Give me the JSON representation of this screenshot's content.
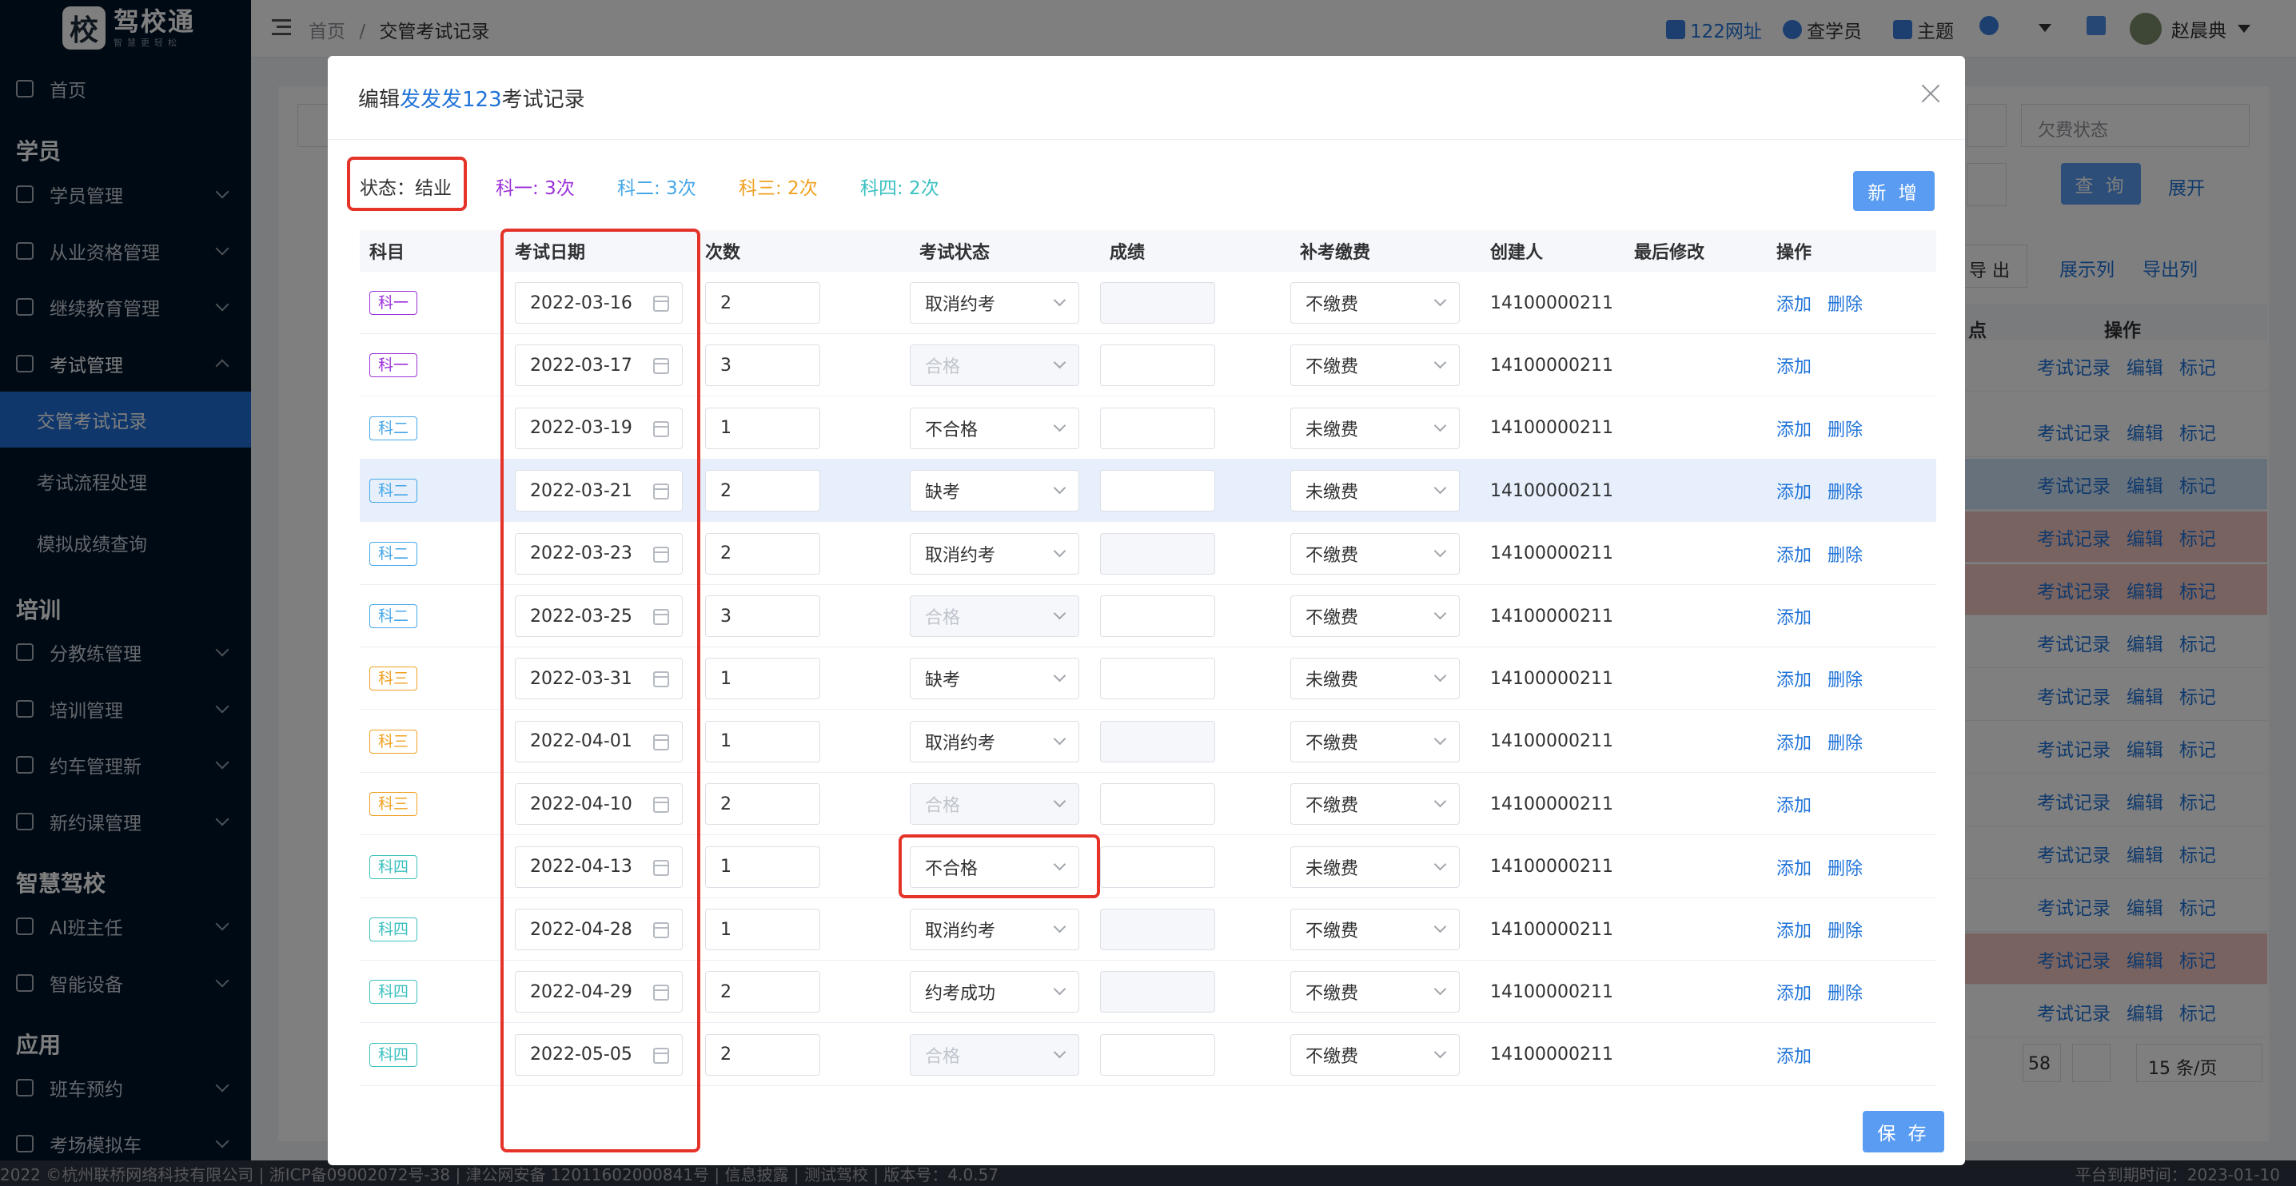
{
  "brand": {
    "name": "驾校通",
    "subtitle": "智慧更轻松",
    "logo_char": "校"
  },
  "sidebar": {
    "home": "首页",
    "groups": [
      {
        "label": "学员",
        "items": [
          {
            "label": "学员管理"
          },
          {
            "label": "从业资格管理"
          },
          {
            "label": "继续教育管理"
          },
          {
            "label": "考试管理",
            "children": [
              {
                "label": "交管考试记录",
                "active": true
              },
              {
                "label": "考试流程处理"
              },
              {
                "label": "模拟成绩查询"
              }
            ]
          }
        ]
      },
      {
        "label": "培训",
        "items": [
          {
            "label": "分教练管理"
          },
          {
            "label": "培训管理"
          },
          {
            "label": "约车管理新"
          },
          {
            "label": "新约课管理"
          }
        ]
      },
      {
        "label": "智慧驾校",
        "items": [
          {
            "label": "AI班主任"
          },
          {
            "label": "智能设备"
          }
        ]
      },
      {
        "label": "应用",
        "items": [
          {
            "label": "班车预约"
          },
          {
            "label": "考场模拟车"
          }
        ]
      }
    ]
  },
  "header": {
    "breadcrumb_home": "首页",
    "breadcrumb_sep": "/",
    "breadcrumb_current": "交管考试记录",
    "links": [
      "122网址",
      "查学员",
      "主题"
    ],
    "user": "赵晨典"
  },
  "background": {
    "select_arrears": "欠费状态",
    "query": "查 询",
    "expand": "展开",
    "export": "导 出",
    "show_cols": "展示列",
    "export_cols": "导出列",
    "op_header": "操作",
    "point_header": "点",
    "ops": [
      "考试记录",
      "编辑",
      "标记"
    ],
    "page_num": "58",
    "page_size": "15 条/页"
  },
  "footer": {
    "left": "2022 ©杭州联桥网络科技有限公司 | 浙ICP备09002072号-38 | 津公网安备 12011602000841号 | 信息披露 | 测试驾校 | 版本号：4.0.57",
    "right": "平台到期时间：2023-01-10"
  },
  "modal": {
    "title_prefix": "编辑",
    "student_name": "发发发123",
    "title_suffix": "考试记录",
    "status": "状态：结业",
    "stats": [
      {
        "text": "科一: 3次",
        "color": "#9b30d9"
      },
      {
        "text": "科二: 3次",
        "color": "#45a7e8"
      },
      {
        "text": "科三: 2次",
        "color": "#f0a020"
      },
      {
        "text": "科四: 2次",
        "color": "#3cc0c0"
      }
    ],
    "add_button": "新 增",
    "save_button": "保 存",
    "columns": [
      "科目",
      "考试日期",
      "次数",
      "考试状态",
      "成绩",
      "补考缴费",
      "创建人",
      "最后修改",
      "操作"
    ],
    "add_label": "添加",
    "delete_label": "删除",
    "subject_colors": {
      "科一": "#9b30d9",
      "科二": "#45a7e8",
      "科三": "#f0a020",
      "科四": "#3cc0c0"
    },
    "rows": [
      {
        "subject": "科一",
        "date": "2022-03-16",
        "count": "2",
        "status": "取消约考",
        "status_disabled": false,
        "score_disabled": true,
        "fee": "不缴费",
        "creator": "14100000211",
        "can_delete": true
      },
      {
        "subject": "科一",
        "date": "2022-03-17",
        "count": "3",
        "status": "合格",
        "status_disabled": true,
        "score_disabled": false,
        "fee": "不缴费",
        "creator": "14100000211",
        "can_delete": false
      },
      {
        "subject": "科二",
        "date": "2022-03-19",
        "count": "1",
        "status": "不合格",
        "status_disabled": false,
        "score_disabled": false,
        "fee": "未缴费",
        "creator": "14100000211",
        "can_delete": true
      },
      {
        "subject": "科二",
        "date": "2022-03-21",
        "count": "2",
        "status": "缺考",
        "status_disabled": false,
        "score_disabled": false,
        "fee": "未缴费",
        "creator": "14100000211",
        "can_delete": true,
        "highlight": true
      },
      {
        "subject": "科二",
        "date": "2022-03-23",
        "count": "2",
        "status": "取消约考",
        "status_disabled": false,
        "score_disabled": true,
        "fee": "不缴费",
        "creator": "14100000211",
        "can_delete": true
      },
      {
        "subject": "科二",
        "date": "2022-03-25",
        "count": "3",
        "status": "合格",
        "status_disabled": true,
        "score_disabled": false,
        "fee": "不缴费",
        "creator": "14100000211",
        "can_delete": false
      },
      {
        "subject": "科三",
        "date": "2022-03-31",
        "count": "1",
        "status": "缺考",
        "status_disabled": false,
        "score_disabled": false,
        "fee": "未缴费",
        "creator": "14100000211",
        "can_delete": true
      },
      {
        "subject": "科三",
        "date": "2022-04-01",
        "count": "1",
        "status": "取消约考",
        "status_disabled": false,
        "score_disabled": true,
        "fee": "不缴费",
        "creator": "14100000211",
        "can_delete": true
      },
      {
        "subject": "科三",
        "date": "2022-04-10",
        "count": "2",
        "status": "合格",
        "status_disabled": true,
        "score_disabled": false,
        "fee": "不缴费",
        "creator": "14100000211",
        "can_delete": false
      },
      {
        "subject": "科四",
        "date": "2022-04-13",
        "count": "1",
        "status": "不合格",
        "status_disabled": false,
        "score_disabled": false,
        "fee": "未缴费",
        "creator": "14100000211",
        "can_delete": true
      },
      {
        "subject": "科四",
        "date": "2022-04-28",
        "count": "1",
        "status": "取消约考",
        "status_disabled": false,
        "score_disabled": true,
        "fee": "不缴费",
        "creator": "14100000211",
        "can_delete": true
      },
      {
        "subject": "科四",
        "date": "2022-04-29",
        "count": "2",
        "status": "约考成功",
        "status_disabled": false,
        "score_disabled": true,
        "fee": "不缴费",
        "creator": "14100000211",
        "can_delete": true
      },
      {
        "subject": "科四",
        "date": "2022-05-05",
        "count": "2",
        "status": "合格",
        "status_disabled": true,
        "score_disabled": false,
        "fee": "不缴费",
        "creator": "14100000211",
        "can_delete": false
      }
    ]
  }
}
